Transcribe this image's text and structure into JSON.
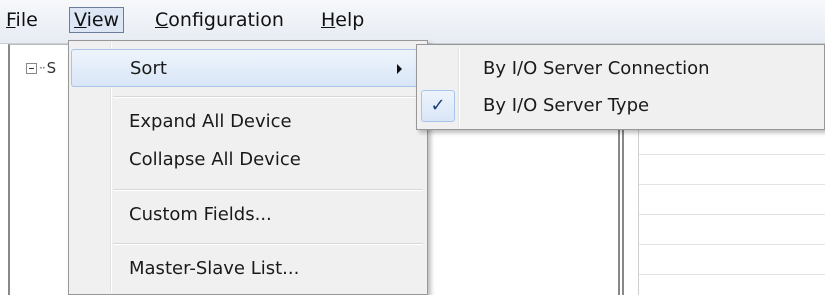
{
  "menubar": {
    "items": [
      {
        "mnemonic": "F",
        "rest": "ile"
      },
      {
        "mnemonic": "V",
        "rest": "iew"
      },
      {
        "mnemonic": "C",
        "rest": "onfiguration"
      },
      {
        "mnemonic": "H",
        "rest": "elp"
      }
    ]
  },
  "tree": {
    "root_label": "S"
  },
  "view_menu": {
    "items": [
      {
        "label": "Sort",
        "has_submenu": true
      },
      {
        "label": "Expand All Device"
      },
      {
        "label": "Collapse All Device"
      },
      {
        "label": "Custom Fields..."
      },
      {
        "label": "Master-Slave List..."
      }
    ]
  },
  "sort_submenu": {
    "items": [
      {
        "label": "By I/O Server Connection",
        "checked": false
      },
      {
        "label": "By I/O Server Type",
        "checked": true
      }
    ],
    "check_glyph": "✓"
  }
}
